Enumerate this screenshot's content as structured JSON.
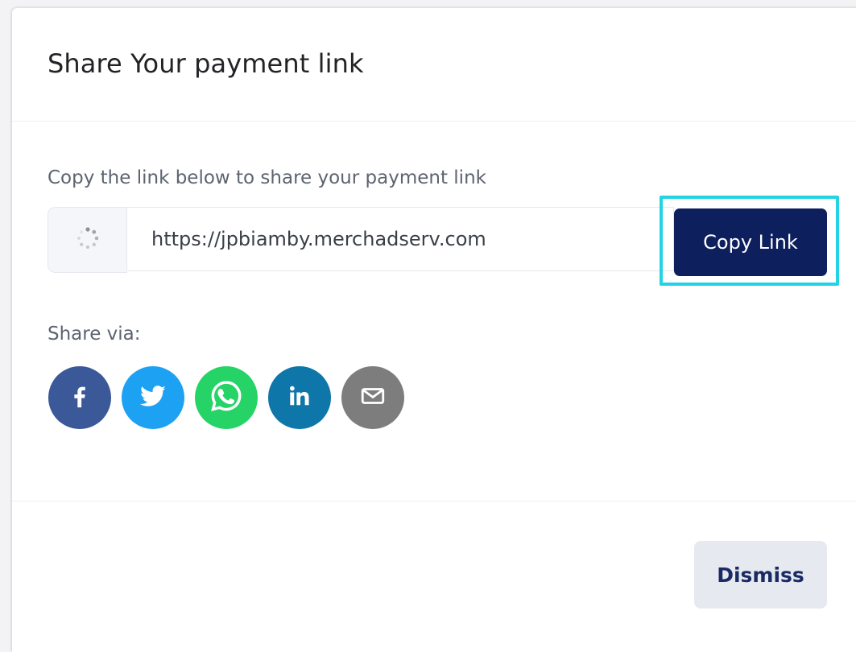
{
  "modal": {
    "title": "Share Your payment link",
    "instruction": "Copy the link below to share your payment link",
    "link_url": "https://jpbiamby.merchadserv.com",
    "copy_button_label": "Copy Link",
    "share_label": "Share via:",
    "share_options": [
      {
        "name": "facebook",
        "icon": "facebook-icon",
        "color": "#3b5998"
      },
      {
        "name": "twitter",
        "icon": "twitter-icon",
        "color": "#1da1f2"
      },
      {
        "name": "whatsapp",
        "icon": "whatsapp-icon",
        "color": "#25d366"
      },
      {
        "name": "linkedin",
        "icon": "linkedin-icon",
        "color": "#0e76a8"
      },
      {
        "name": "email",
        "icon": "email-icon",
        "color": "#7d7d7d"
      }
    ],
    "dismiss_label": "Dismiss"
  },
  "colors": {
    "primary_button": "#0d1f5c",
    "highlight_outline": "#22d3e6",
    "secondary_button": "#e6e9f0"
  }
}
